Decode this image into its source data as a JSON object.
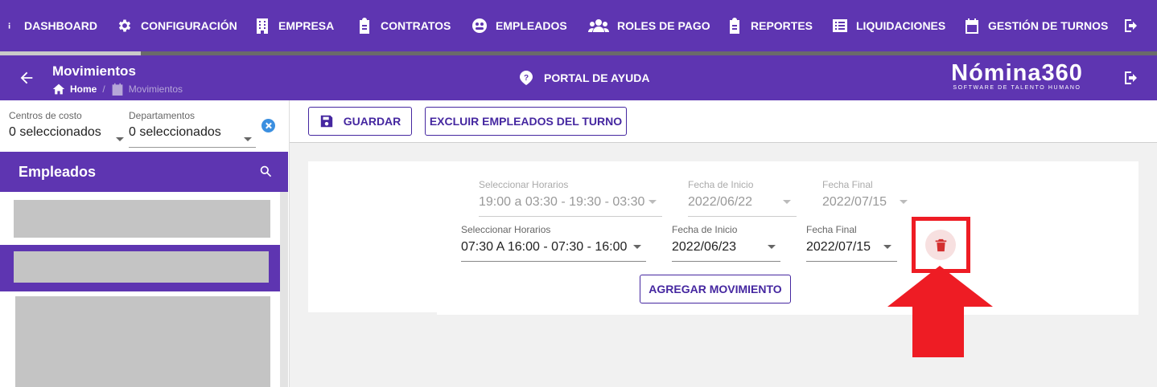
{
  "nav": {
    "items": [
      {
        "label": "DASHBOARD",
        "icon": "info-icon"
      },
      {
        "label": "CONFIGURACIÓN",
        "icon": "gear-icon"
      },
      {
        "label": "EMPRESA",
        "icon": "building-icon"
      },
      {
        "label": "CONTRATOS",
        "icon": "clipboard-icon"
      },
      {
        "label": "EMPLEADOS",
        "icon": "users-cog-icon"
      },
      {
        "label": "ROLES DE PAGO",
        "icon": "group-icon"
      },
      {
        "label": "REPORTES",
        "icon": "clipboard-icon"
      },
      {
        "label": "LIQUIDACIONES",
        "icon": "list-icon"
      },
      {
        "label": "GESTIÓN DE TURNOS",
        "icon": "calendar-icon"
      }
    ],
    "logout_icon": "logout-icon",
    "progress": 0.122
  },
  "header": {
    "title": "Movimientos",
    "breadcrumb_home": "Home",
    "breadcrumb_sep": "/",
    "breadcrumb_current": "Movimientos",
    "help_label": "PORTAL DE AYUDA",
    "brand_name": "Nómina360",
    "brand_tagline": "SOFTWARE DE TALENTO HUMANO"
  },
  "filters": {
    "cost_centers_label": "Centros de costo",
    "cost_centers_value": "0 seleccionados",
    "departments_label": "Departamentos",
    "departments_value": "0 seleccionados"
  },
  "employees": {
    "title": "Empleados"
  },
  "toolbar": {
    "save_label": "GUARDAR",
    "exclude_label": "EXCLUIR EMPLEADOS DEL TURNO"
  },
  "movements": {
    "rows": [
      {
        "schedule_label": "Seleccionar Horarios",
        "schedule_value": "19:00 a 03:30 - 19:30 - 03:30",
        "start_label": "Fecha de Inicio",
        "start_value": "2022/06/22",
        "end_label": "Fecha Final",
        "end_value": "2022/07/15",
        "disabled": true
      },
      {
        "schedule_label": "Seleccionar Horarios",
        "schedule_value": "07:30 A 16:00 - 07:30 - 16:00",
        "start_label": "Fecha de Inicio",
        "start_value": "2022/06/23",
        "end_label": "Fecha Final",
        "end_value": "2022/07/15",
        "disabled": false
      }
    ],
    "add_label": "AGREGAR MOVIMIENTO"
  },
  "colors": {
    "primary": "#5e35b1",
    "primary_dark": "#4527a0",
    "delete": "#d32f2f",
    "annotation": "#ee1c24"
  }
}
